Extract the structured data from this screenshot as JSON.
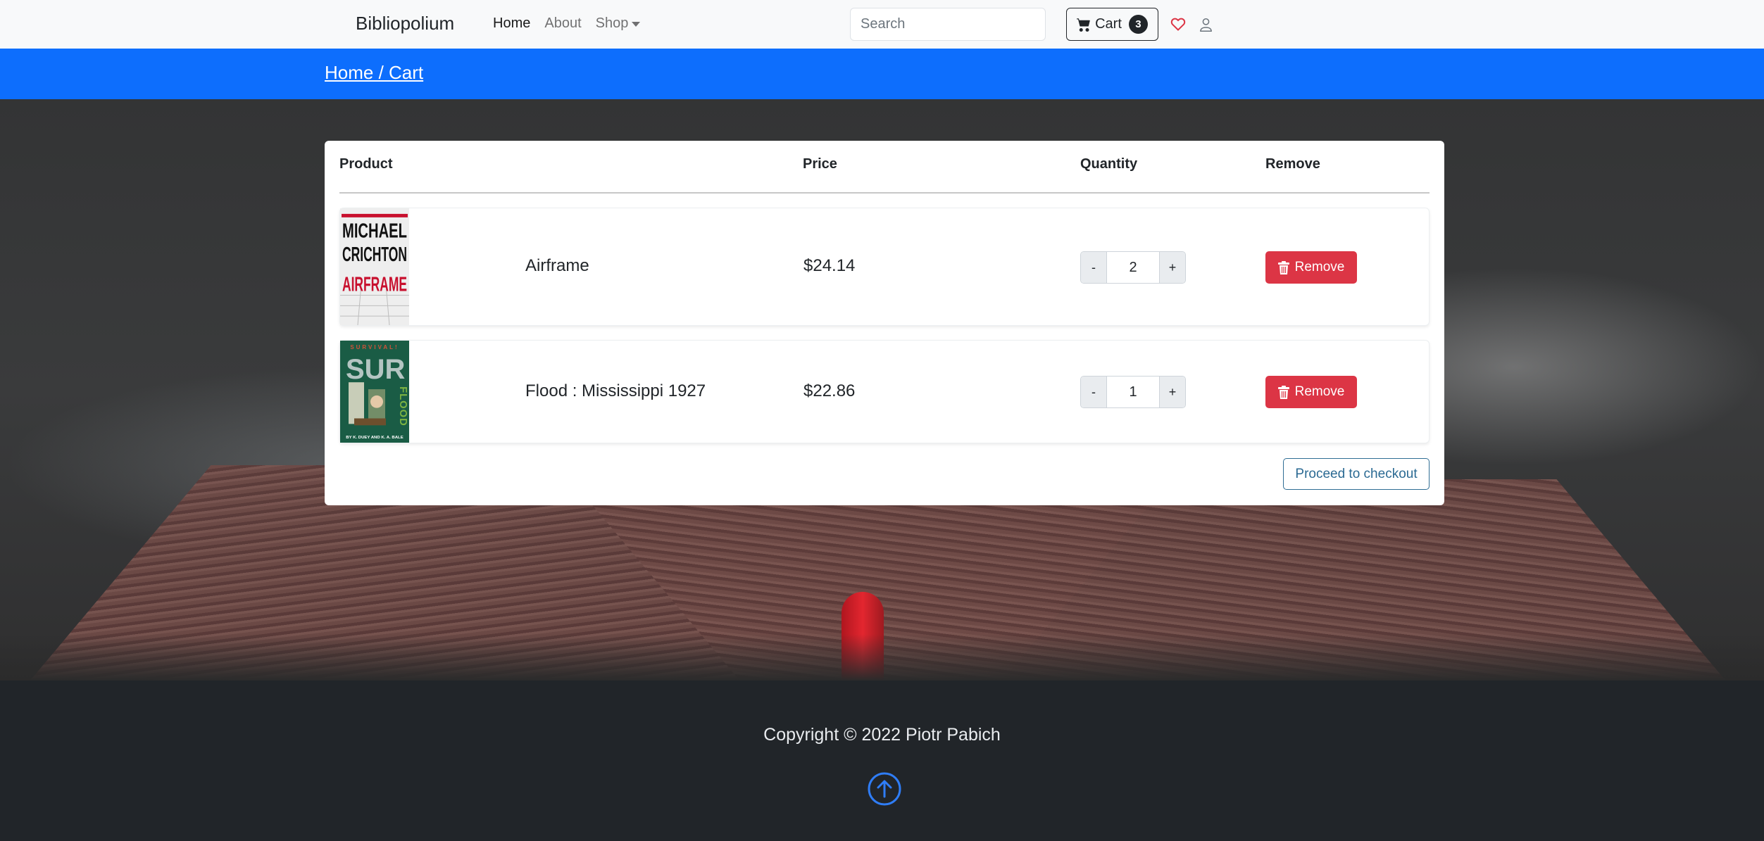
{
  "navbar": {
    "brand": "Bibliopolium",
    "links": [
      {
        "label": "Home",
        "active": true
      },
      {
        "label": "About",
        "active": false
      },
      {
        "label": "Shop",
        "active": false,
        "dropdown": true
      }
    ],
    "search_placeholder": "Search",
    "search_value": "",
    "cart_label": "Cart",
    "cart_count": "3",
    "icons": [
      "cart-icon",
      "heart-icon",
      "person-icon"
    ]
  },
  "breadcrumb": {
    "text": "Home / Cart"
  },
  "cart": {
    "headers": {
      "product": "Product",
      "price": "Price",
      "quantity": "Quantity",
      "remove": "Remove"
    },
    "items": [
      {
        "name": "Airframe",
        "price": "$24.14",
        "quantity": "2",
        "minus": "-",
        "plus": "+",
        "remove_label": "Remove",
        "cover": {
          "author": "MICHAEL CRICHTON",
          "title": "AIRFRAME"
        }
      },
      {
        "name": "Flood : Mississippi 1927",
        "price": "$22.86",
        "quantity": "1",
        "minus": "-",
        "plus": "+",
        "remove_label": "Remove",
        "cover": {
          "series": "SURVIVAL!",
          "title": "FLOOD",
          "byline": "BY K. DUEY AND K. A. BALE"
        }
      }
    ],
    "checkout_label": "Proceed to checkout"
  },
  "footer": {
    "copyright": "Copyright © 2022 Piotr Pabich",
    "back_to_top_icon": "arrow-up-circle-icon"
  },
  "colors": {
    "primary": "#0d6efd",
    "danger": "#dc3545",
    "dark": "#212529",
    "navbar_bg": "#f8f9fa",
    "checkout_outline": "#2f6d94"
  }
}
